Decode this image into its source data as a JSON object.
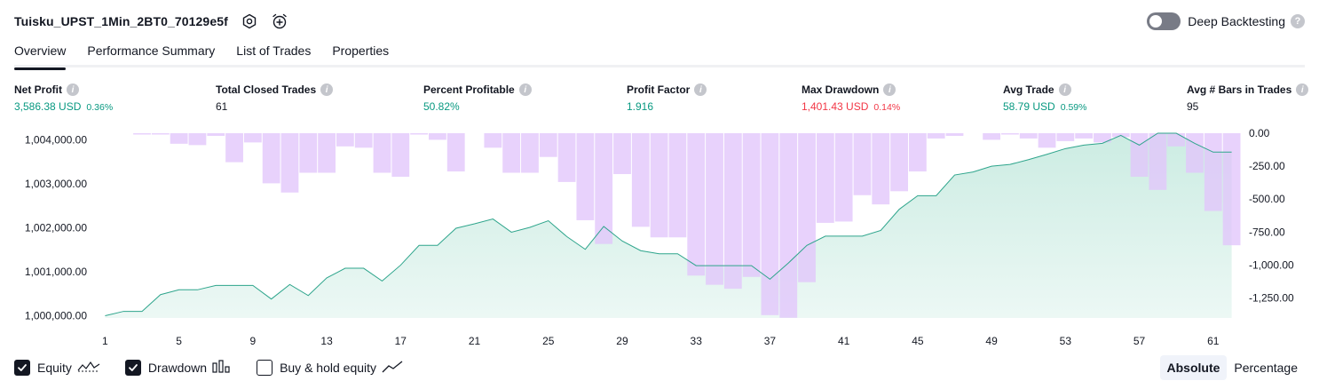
{
  "header": {
    "strategy_name": "Tuisku_UPST_1Min_2BT0_70129e5f",
    "settings_icon": "gear-icon",
    "alert_icon": "alarm-clock-plus-icon",
    "deep_backtesting_label": "Deep Backtesting",
    "deep_backtesting_enabled": false,
    "help_glyph": "?"
  },
  "tabs": [
    {
      "label": "Overview",
      "active": true
    },
    {
      "label": "Performance Summary",
      "active": false
    },
    {
      "label": "List of Trades",
      "active": false
    },
    {
      "label": "Properties",
      "active": false
    }
  ],
  "metrics": [
    {
      "label": "Net Profit",
      "value": "3,586.38 USD",
      "pct": "0.36%",
      "tone": "green"
    },
    {
      "label": "Total Closed Trades",
      "value": "61",
      "pct": "",
      "tone": "dark"
    },
    {
      "label": "Percent Profitable",
      "value": "50.82%",
      "pct": "",
      "tone": "green"
    },
    {
      "label": "Profit Factor",
      "value": "1.916",
      "pct": "",
      "tone": "green"
    },
    {
      "label": "Max Drawdown",
      "value": "1,401.43 USD",
      "pct": "0.14%",
      "tone": "red"
    },
    {
      "label": "Avg Trade",
      "value": "58.79 USD",
      "pct": "0.59%",
      "tone": "green"
    },
    {
      "label": "Avg # Bars in Trades",
      "value": "95",
      "pct": "",
      "tone": "dark"
    }
  ],
  "info_glyph": "i",
  "colors": {
    "equity_line": "#2ea58c",
    "equity_fill": "#c9ebe1",
    "drawdown_bar": "#e2c5fb",
    "overlap_bar": "#b8b6ee",
    "positive": "#089981",
    "negative": "#f23645"
  },
  "chart_data": {
    "type": "area",
    "x_ticks": [
      1,
      5,
      9,
      13,
      17,
      21,
      25,
      29,
      33,
      37,
      41,
      45,
      49,
      53,
      57,
      61
    ],
    "left_axis": {
      "ticks": [
        "1,000,000.00",
        "1,001,000.00",
        "1,002,000.00",
        "1,003,000.00",
        "1,004,000.00"
      ],
      "range": [
        999950,
        1004150
      ]
    },
    "right_axis": {
      "ticks": [
        "0.00",
        "-250.00",
        "-500.00",
        "-750.00",
        "-1,000.00",
        "-1,250.00"
      ],
      "range": [
        -1401.43,
        0
      ]
    },
    "series": [
      {
        "name": "Equity",
        "x": [
          1,
          2,
          3,
          4,
          5,
          6,
          7,
          8,
          9,
          10,
          11,
          12,
          13,
          14,
          15,
          16,
          17,
          18,
          19,
          20,
          21,
          22,
          23,
          24,
          25,
          26,
          27,
          28,
          29,
          30,
          31,
          32,
          33,
          34,
          35,
          36,
          37,
          38,
          39,
          40,
          41,
          42,
          43,
          44,
          45,
          46,
          47,
          48,
          49,
          50,
          51,
          52,
          53,
          54,
          55,
          56,
          57,
          58,
          59,
          60,
          61,
          62
        ],
        "values": [
          1000000,
          1000100,
          1000100,
          1000480,
          1000590,
          1000590,
          1000690,
          1000690,
          1000690,
          1000380,
          1000710,
          1000460,
          1000860,
          1001080,
          1001080,
          1000790,
          1001150,
          1001600,
          1001600,
          1001990,
          1002090,
          1002200,
          1001900,
          1002010,
          1002160,
          1001800,
          1001510,
          1002030,
          1001700,
          1001480,
          1001410,
          1001410,
          1001140,
          1001140,
          1001140,
          1001140,
          1000830,
          1001200,
          1001600,
          1001810,
          1001810,
          1001810,
          1001940,
          1002420,
          1002730,
          1002730,
          1003200,
          1003270,
          1003400,
          1003440,
          1003550,
          1003670,
          1003800,
          1003880,
          1003920,
          1004100,
          1003880,
          1004150,
          1004150,
          1003920,
          1003720,
          1003720
        ]
      },
      {
        "name": "Drawdown",
        "x": [
          1,
          2,
          3,
          4,
          5,
          6,
          7,
          8,
          9,
          10,
          11,
          12,
          13,
          14,
          15,
          16,
          17,
          18,
          19,
          20,
          21,
          22,
          23,
          24,
          25,
          26,
          27,
          28,
          29,
          30,
          31,
          32,
          33,
          34,
          35,
          36,
          37,
          38,
          39,
          40,
          41,
          42,
          43,
          44,
          45,
          46,
          47,
          48,
          49,
          50,
          51,
          52,
          53,
          54,
          55,
          56,
          57,
          58,
          59,
          60,
          61,
          62
        ],
        "values": [
          0,
          0,
          -10,
          -10,
          -80,
          -90,
          -20,
          -220,
          -70,
          -380,
          -450,
          -300,
          -300,
          -100,
          -110,
          -300,
          -330,
          -10,
          -50,
          -290,
          0,
          -110,
          -300,
          -300,
          -180,
          -370,
          -660,
          -840,
          -310,
          -710,
          -790,
          -790,
          -1080,
          -1150,
          -1180,
          -1090,
          -1380,
          -1400,
          -1130,
          -680,
          -670,
          -470,
          -540,
          -440,
          -290,
          -40,
          -20,
          0,
          -50,
          -10,
          -40,
          -110,
          -60,
          -40,
          -70,
          -30,
          -330,
          -430,
          -100,
          -300,
          -590,
          -850
        ]
      }
    ],
    "legend_items": [
      {
        "label": "Equity",
        "checked": true,
        "icon": "equity-line-icon"
      },
      {
        "label": "Drawdown",
        "checked": true,
        "icon": "drawdown-bars-icon"
      },
      {
        "label": "Buy & hold equity",
        "checked": false,
        "icon": "buy-hold-line-icon"
      }
    ],
    "scale_modes": [
      {
        "label": "Absolute",
        "selected": true
      },
      {
        "label": "Percentage",
        "selected": false
      }
    ]
  }
}
